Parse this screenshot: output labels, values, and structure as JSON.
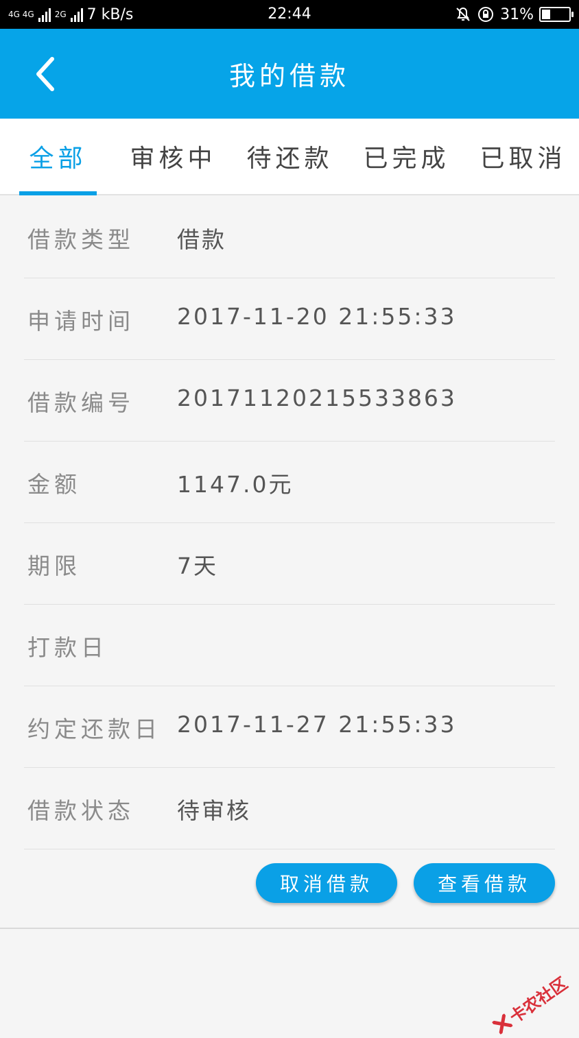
{
  "status_bar": {
    "network_left": "4G 4G",
    "network_right": "2G",
    "speed": "7 kB/s",
    "time": "22:44",
    "battery": "31%",
    "battery_level": 0.31
  },
  "header": {
    "title": "我的借款"
  },
  "tabs": [
    {
      "label": "全部",
      "active": true
    },
    {
      "label": "审核中",
      "active": false
    },
    {
      "label": "待还款",
      "active": false
    },
    {
      "label": "已完成",
      "active": false
    },
    {
      "label": "已取消",
      "active": false
    }
  ],
  "loan": {
    "rows": [
      {
        "label": "借款类型",
        "value": "借款"
      },
      {
        "label": "申请时间",
        "value": "2017-11-20 21:55:33"
      },
      {
        "label": "借款编号",
        "value": "20171120215533863"
      },
      {
        "label": "金额",
        "value": "1147.0元"
      },
      {
        "label": "期限",
        "value": "7天"
      },
      {
        "label": "打款日",
        "value": ""
      },
      {
        "label": "约定还款日",
        "value": "2017-11-27 21:55:33"
      },
      {
        "label": "借款状态",
        "value": "待审核"
      }
    ],
    "cancel_label": "取消借款",
    "view_label": "查看借款"
  },
  "watermark": {
    "text": "卡农社区"
  },
  "colors": {
    "accent": "#06a4e8",
    "tab_active": "#0aa0e6"
  }
}
